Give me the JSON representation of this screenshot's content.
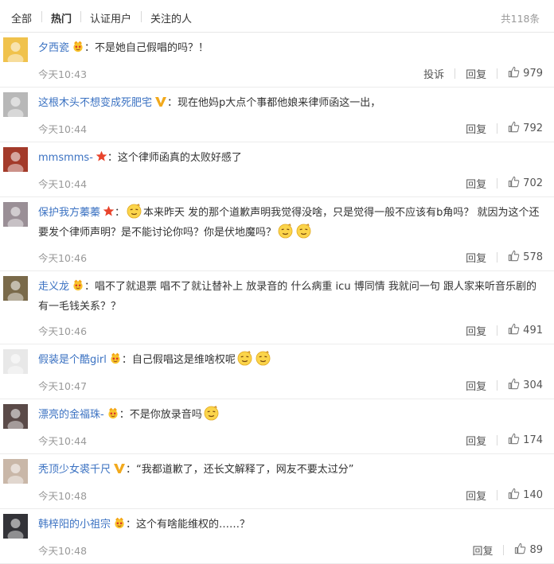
{
  "tabs": [
    "全部",
    "热门",
    "认证用户",
    "关注的人"
  ],
  "active_tab": 1,
  "total": "共118条",
  "actions": {
    "report": "投诉",
    "reply": "回复"
  },
  "comments": [
    {
      "user": "夕西瓷",
      "badge": "crown-face",
      "text": "不是她自己假唱的吗？！",
      "time": "今天10:43",
      "likes": "979",
      "report": true,
      "emojis": 0,
      "avatar": "#f0c24c"
    },
    {
      "user": "这根木头不想变成死肥宅",
      "badge": "verified-v",
      "text": "现在他妈p大点个事都他娘来律师函这一出，",
      "time": "今天10:44",
      "likes": "792",
      "report": false,
      "emojis": 0,
      "avatar": "#b8b8b8"
    },
    {
      "user": "mmsmms-",
      "badge": "star",
      "text": "这个律师函真的太败好感了",
      "time": "今天10:44",
      "likes": "702",
      "report": false,
      "emojis": 0,
      "avatar": "#a33a2a"
    },
    {
      "user": "保护我方蓁蓁",
      "badge": "star",
      "text": "本来昨天 发的那个道歉声明我觉得没啥，只是觉得一般不应该有b角吗？ 就因为这个还要发个律师声明？是不能讨论你吗？你是伏地魔吗？",
      "time": "今天10:46",
      "likes": "578",
      "report": false,
      "emojis": 2,
      "lead_emoji": true,
      "avatar": "#9a8f96"
    },
    {
      "user": "走义龙",
      "badge": "crown-face",
      "text": "唱不了就退票 唱不了就让替补上 放录音的 什么病重 icu 博同情 我就问一句 跟人家来听音乐剧的有一毛钱关系？？",
      "time": "今天10:46",
      "likes": "491",
      "report": false,
      "emojis": 0,
      "avatar": "#7a6a4a"
    },
    {
      "user": "假装是个酷girl",
      "badge": "crown-face",
      "text": "自己假唱这是维啥权呢",
      "time": "今天10:47",
      "likes": "304",
      "report": false,
      "emojis": 2,
      "avatar": "#e8e8e8"
    },
    {
      "user": "漂亮的金福珠-",
      "badge": "crown-face",
      "text": "不是你放录音吗",
      "time": "今天10:44",
      "likes": "174",
      "report": false,
      "emojis": 1,
      "avatar": "#5a4a48"
    },
    {
      "user": "秃顶少女裘千尺",
      "badge": "verified-v",
      "text": "“我都道歉了，还长文解释了，网友不要太过分”",
      "time": "今天10:48",
      "likes": "140",
      "report": false,
      "emojis": 0,
      "avatar": "#c9b7a8"
    },
    {
      "user": "韩梓阳的小祖宗",
      "badge": "crown-face",
      "text": "这个有啥能维权的……？",
      "time": "今天10:48",
      "likes": "89",
      "report": false,
      "emojis": 0,
      "avatar": "#333338"
    }
  ]
}
